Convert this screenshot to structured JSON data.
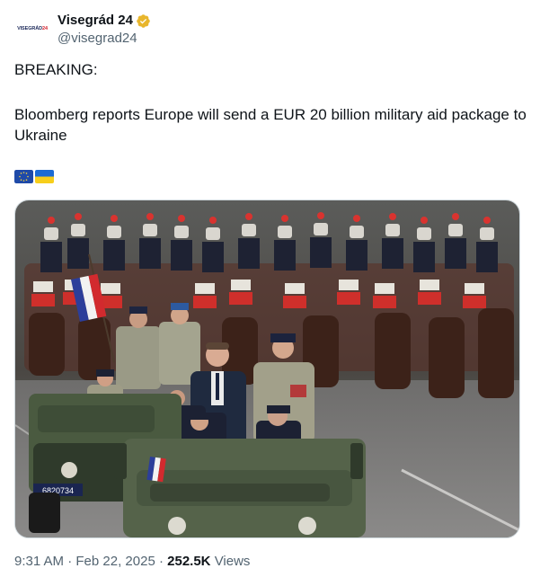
{
  "author": {
    "avatar_text_a": "VISEGRÁD",
    "avatar_text_b": "24",
    "display_name": "Visegrád 24",
    "handle": "@visegrad24",
    "verified_color": "#e8b62c"
  },
  "tweet": {
    "line1": "BREAKING:",
    "line2": "Bloomberg reports Europe will send a EUR 20 billion military aid package to Ukraine",
    "flags": [
      "eu-flag-icon",
      "ukraine-flag-icon"
    ]
  },
  "media": {
    "plate": "6820734"
  },
  "meta": {
    "time": "9:31 AM",
    "sep": "·",
    "date": "Feb 22, 2025",
    "sep2": "·",
    "views_count": "252.5K",
    "views_label": "Views"
  }
}
